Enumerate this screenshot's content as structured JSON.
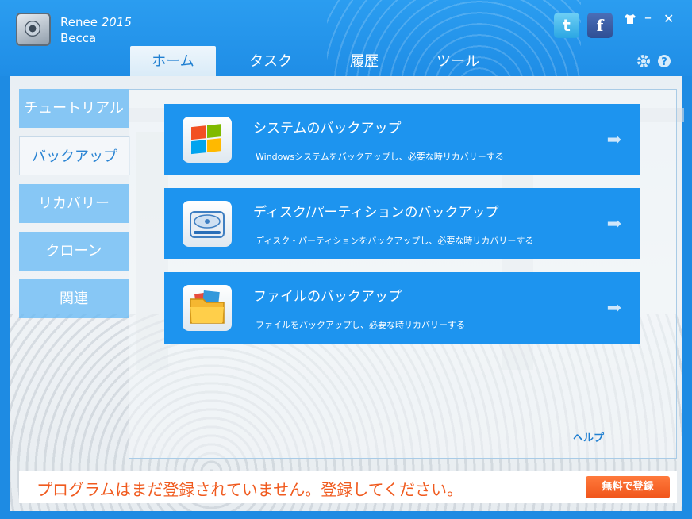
{
  "app": {
    "name": "Renee",
    "version": "2015",
    "edition": "Becca"
  },
  "tabs": [
    {
      "label": "ホーム",
      "active": true
    },
    {
      "label": "タスク",
      "active": false
    },
    {
      "label": "履歴",
      "active": false
    },
    {
      "label": "ツール",
      "active": false
    }
  ],
  "window_controls": {
    "minimize": "–",
    "close": "✕",
    "settings_icon": "gear-icon",
    "help_icon": "question-icon",
    "skin_icon": "shirt-icon"
  },
  "social": {
    "twitter": "t",
    "facebook": "f"
  },
  "sidebar": {
    "items": [
      {
        "label": "チュートリアル",
        "active": false
      },
      {
        "label": "バックアップ",
        "active": true
      },
      {
        "label": "リカバリー",
        "active": false
      },
      {
        "label": "クローン",
        "active": false
      },
      {
        "label": "関連",
        "active": false
      }
    ]
  },
  "cards": [
    {
      "title": "システムのバックアップ",
      "desc": "Windowsシステムをバックアップし、必要な時リカバリーする",
      "icon": "windows-icon"
    },
    {
      "title": "ディスク/パーティションのバックアップ",
      "desc": "ディスク・パーティションをバックアップし、必要な時リカバリーする",
      "icon": "disk-icon"
    },
    {
      "title": "ファイルのバックアップ",
      "desc": "ファイルをバックアップし、必要な時リカバリーする",
      "icon": "folder-icon"
    }
  ],
  "help_link": "ヘルプ",
  "registration": {
    "message": "プログラムはまだ登録されていません。登録してください。",
    "button": "無料で登録"
  },
  "colors": {
    "accent": "#1d94ef",
    "warning": "#f05a1e",
    "button": "#f0541a"
  }
}
